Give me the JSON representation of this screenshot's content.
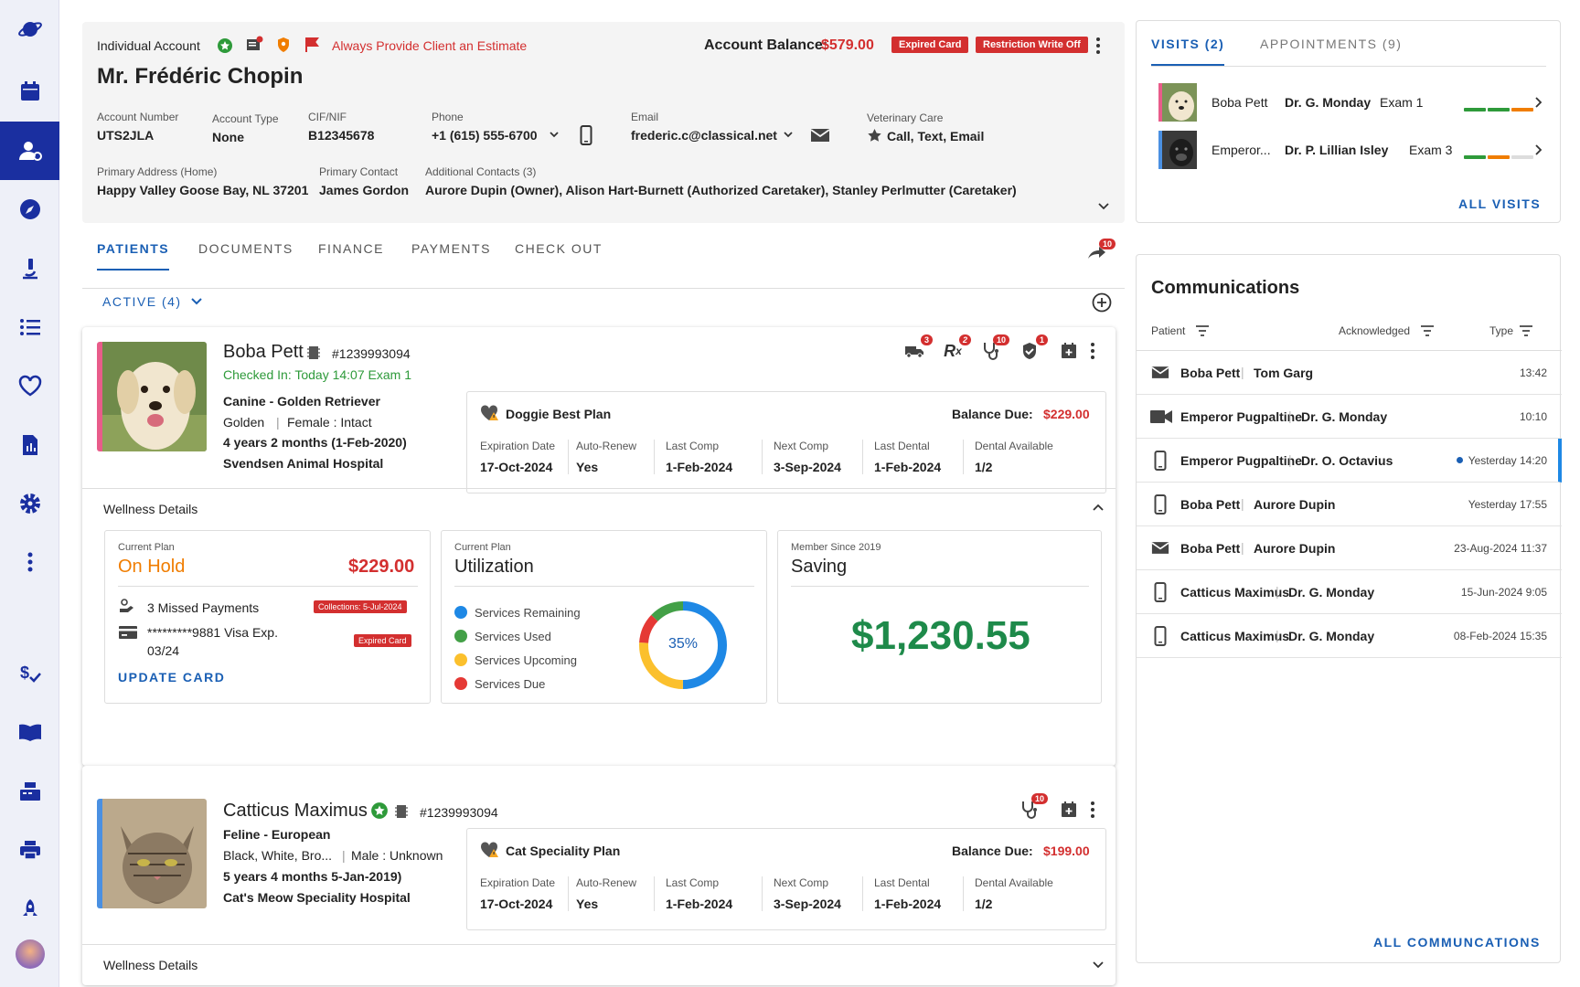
{
  "account": {
    "type_label": "Individual Account",
    "alert": "Always Provide Client an Estimate",
    "balance_label": "Account Balance:",
    "balance": "$579.00",
    "tags": [
      "Expired Card",
      "Restriction Write Off"
    ],
    "client_name": "Mr. Frédéric Chopin",
    "fields": [
      {
        "label": "Account Number",
        "value": "UTS2JLA"
      },
      {
        "label": "Account Type",
        "value": "None"
      },
      {
        "label": "CIF/NIF",
        "value": "B12345678"
      },
      {
        "label": "Phone",
        "value": "+1 (615) 555-6700"
      },
      {
        "label": "Email",
        "value": "frederic.c@classical.net"
      },
      {
        "label": "Veterinary Care",
        "value": "Call, Text, Email"
      }
    ],
    "address_label": "Primary Address (Home)",
    "address": "Happy Valley Goose Bay, NL 37201",
    "primary_contact_label": "Primary Contact",
    "primary_contact": "James Gordon",
    "additional_label": "Additional Contacts (3)",
    "additional": "Aurore Dupin (Owner), Alison Hart-Burnett (Authorized Caretaker), Stanley Perlmutter (Caretaker)"
  },
  "tabs": [
    "PATIENTS",
    "DOCUMENTS",
    "FINANCE",
    "PAYMENTS",
    "CHECK OUT"
  ],
  "share_badge": "10",
  "active_filter": "ACTIVE (4)",
  "patients": [
    {
      "name": "Boba Pett",
      "id": "#1239993094",
      "checkin": "Checked In: Today 14:07 Exam 1",
      "breed": "Canine - Golden Retriever",
      "color": "Golden",
      "sex": "Female : Intact",
      "age": "4 years 2 months  (1-Feb-2020)",
      "hospital": "Svendsen Animal Hospital",
      "icon_badges": [
        "3",
        "2",
        "10",
        "1"
      ],
      "plan": {
        "name": "Doggie Best Plan",
        "balance_label": "Balance Due:",
        "balance": "$229.00",
        "cols": [
          {
            "label": "Expiration Date",
            "value": "17-Oct-2024"
          },
          {
            "label": "Auto-Renew",
            "value": "Yes"
          },
          {
            "label": "Last Comp",
            "value": "1-Feb-2024"
          },
          {
            "label": "Next Comp",
            "value": "3-Sep-2024"
          },
          {
            "label": "Last Dental",
            "value": "1-Feb-2024"
          },
          {
            "label": "Dental Available",
            "value": "1/2"
          }
        ]
      },
      "wellness_label": "Wellness Details"
    },
    {
      "name": "Catticus Maximus",
      "id": "#1239993094",
      "breed": "Feline - European",
      "color": "Black, White, Bro...",
      "sex": "Male : Unknown",
      "age": "5 years 4 months  5-Jan-2019)",
      "hospital": "Cat's Meow Speciality Hospital",
      "icon_badges": [
        "10"
      ],
      "plan": {
        "name": "Cat Speciality Plan",
        "balance_label": "Balance Due:",
        "balance": "$199.00",
        "cols": [
          {
            "label": "Expiration Date",
            "value": "17-Oct-2024"
          },
          {
            "label": "Auto-Renew",
            "value": "Yes"
          },
          {
            "label": "Last Comp",
            "value": "1-Feb-2024"
          },
          {
            "label": "Next Comp",
            "value": "3-Sep-2024"
          },
          {
            "label": "Last Dental",
            "value": "1-Feb-2024"
          },
          {
            "label": "Dental Available",
            "value": "1/2"
          }
        ]
      },
      "wellness_label": "Wellness Details"
    }
  ],
  "wellness": {
    "plan_box": {
      "label": "Current Plan",
      "status": "On Hold",
      "amount": "$229.00",
      "missed": "3 Missed Payments",
      "collections_tag": "Collections: 5-Jul-2024",
      "card": "*********9881  Visa Exp.",
      "card_exp": "03/24",
      "expired_tag": "Expired Card",
      "update_link": "UPDATE CARD"
    },
    "util_box": {
      "label": "Current Plan",
      "title": "Utilization",
      "legend": [
        {
          "name": "Services Remaining",
          "color": "#1e88e5"
        },
        {
          "name": "Services Used",
          "color": "#43a047"
        },
        {
          "name": "Services Upcoming",
          "color": "#fbc02d"
        },
        {
          "name": "Services Due",
          "color": "#e53935"
        }
      ],
      "percent": "35%"
    },
    "saving_box": {
      "label": "Member Since 2019",
      "title": "Saving",
      "amount": "$1,230.55"
    }
  },
  "visits": {
    "tab1": "VISITS (2)",
    "tab2": "APPOINTMENTS (9)",
    "rows": [
      {
        "pet": "Boba Pett",
        "doctor": "Dr. G. Monday",
        "exam": "Exam 1"
      },
      {
        "pet": "Emperor...",
        "doctor": "Dr. P. Lillian Isley",
        "exam": "Exam 3"
      }
    ],
    "all_link": "ALL VISITS"
  },
  "communications": {
    "title": "Communications",
    "headers": [
      "Patient",
      "Acknowledged",
      "Type"
    ],
    "rows": [
      {
        "icon": "mail",
        "pet": "Boba Pett",
        "contact": "Tom Garg",
        "time": "13:42"
      },
      {
        "icon": "video",
        "pet": "Emperor Pugpaltine",
        "contact": "Dr. G. Monday",
        "time": "10:10"
      },
      {
        "icon": "phone",
        "pet": "Emperor Pugpaltine",
        "contact": "Dr. O. Octavius",
        "time": "Yesterday 14:20"
      },
      {
        "icon": "phone",
        "pet": "Boba Pett",
        "contact": "Aurore Dupin",
        "time": "Yesterday 17:55"
      },
      {
        "icon": "mail",
        "pet": "Boba Pett",
        "contact": "Aurore Dupin",
        "time": "23-Aug-2024 11:37"
      },
      {
        "icon": "phone",
        "pet": "Catticus Maximus",
        "contact": "Dr. G. Monday",
        "time": "15-Jun-2024 9:05"
      },
      {
        "icon": "phone",
        "pet": "Catticus Maximus",
        "contact": "Dr. G. Monday",
        "time": "08-Feb-2024 15:35"
      }
    ],
    "all_link": "ALL COMMUNCATIONS"
  }
}
